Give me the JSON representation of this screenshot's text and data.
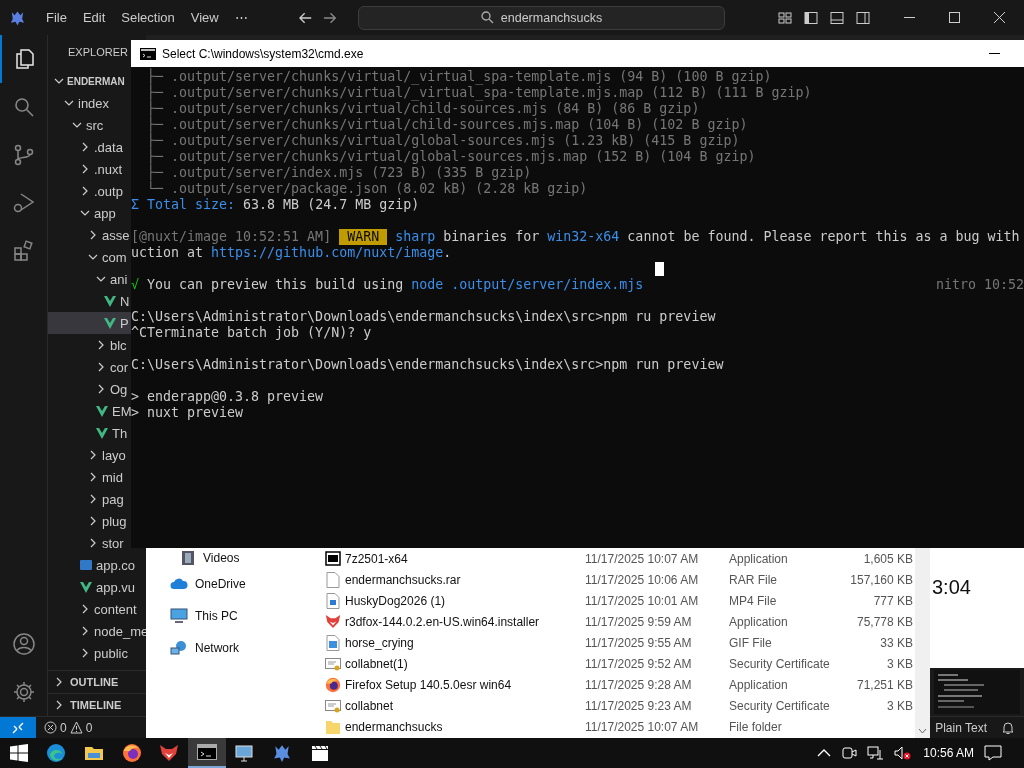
{
  "vscode": {
    "menu": [
      "File",
      "Edit",
      "Selection",
      "View",
      "⋯"
    ],
    "search": {
      "value": "endermanchsucks"
    },
    "activity": [
      {
        "kind": "explorer",
        "selected": true
      },
      {
        "kind": "search",
        "selected": false
      },
      {
        "kind": "source-control",
        "selected": false
      },
      {
        "kind": "run-debug",
        "selected": false
      },
      {
        "kind": "extensions",
        "selected": false
      }
    ],
    "activity_bottom": [
      {
        "kind": "account"
      },
      {
        "kind": "settings"
      }
    ],
    "sidebar": {
      "title": "EXPLORER",
      "tree": [
        {
          "label": "ENDERMAN",
          "kind": "root",
          "expanded": true,
          "selected": false,
          "children": [
            {
              "label": "index",
              "kind": "folder",
              "expanded": true,
              "selected": false,
              "children": [
                {
                  "label": "src",
                  "kind": "folder",
                  "expanded": true,
                  "selected": false,
                  "children": [
                    {
                      "label": ".data",
                      "kind": "folder",
                      "expanded": false,
                      "selected": false
                    },
                    {
                      "label": ".nuxt",
                      "kind": "folder",
                      "expanded": false,
                      "selected": false
                    },
                    {
                      "label": ".outp",
                      "kind": "folder",
                      "expanded": false,
                      "selected": false
                    },
                    {
                      "label": "app",
                      "kind": "folder",
                      "expanded": true,
                      "selected": false,
                      "children": [
                        {
                          "label": "asse",
                          "kind": "folder",
                          "expanded": false,
                          "selected": false
                        },
                        {
                          "label": "com",
                          "kind": "folder",
                          "expanded": true,
                          "selected": false,
                          "children": [
                            {
                              "label": "ani",
                              "kind": "folder",
                              "expanded": true,
                              "selected": false,
                              "children": [
                                {
                                  "label": "N",
                                  "kind": "vue",
                                  "selected": false
                                },
                                {
                                  "label": "P",
                                  "kind": "vue",
                                  "selected": true
                                }
                              ]
                            },
                            {
                              "label": "blc",
                              "kind": "folder",
                              "expanded": false,
                              "selected": false
                            },
                            {
                              "label": "cor",
                              "kind": "folder",
                              "expanded": false,
                              "selected": false
                            },
                            {
                              "label": "Og",
                              "kind": "folder",
                              "expanded": false,
                              "selected": false
                            },
                            {
                              "label": "EM",
                              "kind": "vue",
                              "selected": false
                            },
                            {
                              "label": "Th",
                              "kind": "vue",
                              "selected": false
                            }
                          ]
                        },
                        {
                          "label": "layo",
                          "kind": "folder",
                          "expanded": false,
                          "selected": false
                        },
                        {
                          "label": "mid",
                          "kind": "folder",
                          "expanded": false,
                          "selected": false
                        },
                        {
                          "label": "pag",
                          "kind": "folder",
                          "expanded": false,
                          "selected": false
                        },
                        {
                          "label": "plug",
                          "kind": "folder",
                          "expanded": false,
                          "selected": false
                        },
                        {
                          "label": "stor",
                          "kind": "folder",
                          "expanded": false,
                          "selected": false
                        }
                      ]
                    },
                    {
                      "label": "app.co",
                      "kind": "ts",
                      "selected": false
                    },
                    {
                      "label": "app.vu",
                      "kind": "vue",
                      "selected": false
                    },
                    {
                      "label": "content",
                      "kind": "folder",
                      "expanded": false,
                      "selected": false
                    },
                    {
                      "label": "node_me",
                      "kind": "folder",
                      "expanded": false,
                      "selected": false
                    },
                    {
                      "label": "public",
                      "kind": "folder",
                      "expanded": false,
                      "selected": false
                    }
                  ]
                }
              ]
            }
          ]
        }
      ],
      "sections": [
        {
          "label": "OUTLINE",
          "expanded": false
        },
        {
          "label": "TIMELINE",
          "expanded": false
        }
      ]
    },
    "editor": {
      "text": "3:04"
    },
    "status_bar": {
      "errors": "0",
      "warnings": "0",
      "language": "Plain Text"
    }
  },
  "cmd": {
    "title": "Select C:\\windows\\system32\\cmd.exe",
    "blocks": [
      [
        {
          "segments": [
            {
              "kind": "dim",
              "text": "  ├─ .output/server/chunks/virtual/_virtual_spa-template.mjs (94 B) (100 B gzip)"
            }
          ]
        },
        {
          "segments": [
            {
              "kind": "dim",
              "text": "  ├─ .output/server/chunks/virtual/_virtual_spa-template.mjs.map (112 B) (111 B gzip)"
            }
          ]
        },
        {
          "segments": [
            {
              "kind": "dim",
              "text": "  ├─ .output/server/chunks/virtual/child-sources.mjs (84 B) (86 B gzip)"
            }
          ]
        },
        {
          "segments": [
            {
              "kind": "dim",
              "text": "  ├─ .output/server/chunks/virtual/child-sources.mjs.map (104 B) (102 B gzip)"
            }
          ]
        },
        {
          "segments": [
            {
              "kind": "dim",
              "text": "  ├─ .output/server/chunks/virtual/global-sources.mjs (1.23 kB) (415 B gzip)"
            }
          ]
        },
        {
          "segments": [
            {
              "kind": "dim",
              "text": "  ├─ .output/server/chunks/virtual/global-sources.mjs.map (152 B) (104 B gzip)"
            }
          ]
        },
        {
          "segments": [
            {
              "kind": "dim",
              "text": "  ├─ .output/server/index.mjs (723 B) (335 B gzip)"
            }
          ]
        },
        {
          "segments": [
            {
              "kind": "dim",
              "text": "  └─ .output/server/package.json (8.02 kB) (2.28 kB gzip)"
            }
          ]
        },
        {
          "segments": [
            {
              "kind": "info",
              "text": "Σ Total size:"
            },
            {
              "kind": "plain",
              "text": " 63.8 MB (24.7 MB gzip)"
            }
          ]
        }
      ],
      [
        {
          "segments": [
            {
              "kind": "dim",
              "text": "[@nuxt/image 10:52:51 AM] "
            },
            {
              "kind": "warn",
              "text": "WARN"
            },
            {
              "kind": "info",
              "text": " sharp"
            },
            {
              "kind": "plain",
              "text": " binaries for "
            },
            {
              "kind": "info",
              "text": "win32-x64"
            },
            {
              "kind": "plain",
              "text": " cannot be found. Please report this as a bug with"
            }
          ]
        },
        {
          "segments": [
            {
              "kind": "plain",
              "text": "uction at "
            },
            {
              "kind": "info",
              "text": "https://github.com/nuxt/image"
            },
            {
              "kind": "plain",
              "text": "."
            }
          ]
        },
        {
          "cursor": true
        },
        {
          "segments": [
            {
              "kind": "ok",
              "text": "√"
            },
            {
              "kind": "plain",
              "text": " You can preview this build using "
            },
            {
              "kind": "info",
              "text": "node .output/server/index.mjs"
            },
            {
              "kind": "right",
              "text": "nitro 10:52"
            }
          ]
        }
      ],
      [
        {
          "segments": [
            {
              "kind": "plain",
              "text": "C:\\Users\\Administrator\\Downloads\\endermanchsucks\\index\\src>npm ru preview"
            }
          ]
        },
        {
          "segments": [
            {
              "kind": "plain",
              "text": "^CTerminate batch job (Y/N)? y"
            }
          ]
        }
      ],
      [
        {
          "segments": [
            {
              "kind": "plain",
              "text": "C:\\Users\\Administrator\\Downloads\\endermanchsucks\\index\\src>npm run preview"
            }
          ]
        }
      ],
      [
        {
          "segments": [
            {
              "kind": "plain",
              "text": "> enderapp@0.3.8 preview"
            }
          ]
        },
        {
          "segments": [
            {
              "kind": "plain",
              "text": "> nuxt preview"
            }
          ]
        }
      ]
    ]
  },
  "file_explorer": {
    "nav": [
      {
        "label": "Videos",
        "kind": "videos"
      },
      {
        "label": "OneDrive",
        "kind": "cloud"
      },
      {
        "label": "This PC",
        "kind": "pc"
      },
      {
        "label": "Network",
        "kind": "network"
      }
    ],
    "files": [
      {
        "name": "7z2501-x64",
        "kind": "archive-app",
        "date": "11/17/2025 10:07 AM",
        "type": "Application",
        "size": "1,605 KB"
      },
      {
        "name": "endermanchsucks.rar",
        "kind": "blank",
        "date": "11/17/2025 10:06 AM",
        "type": "RAR File",
        "size": "157,160 KB"
      },
      {
        "name": "HuskyDog2026 (1)",
        "kind": "video",
        "date": "11/17/2025 10:01 AM",
        "type": "MP4 File",
        "size": "777 KB"
      },
      {
        "name": "r3dfox-144.0.2.en-US.win64.installer",
        "kind": "red-fox",
        "date": "11/17/2025 9:59 AM",
        "type": "Application",
        "size": "75,778 KB"
      },
      {
        "name": "horse_crying",
        "kind": "image",
        "date": "11/17/2025 9:55 AM",
        "type": "GIF File",
        "size": "33 KB"
      },
      {
        "name": "collabnet(1)",
        "kind": "certificate",
        "date": "11/17/2025 9:52 AM",
        "type": "Security Certificate",
        "size": "3 KB"
      },
      {
        "name": "Firefox Setup 140.5.0esr win64",
        "kind": "fox-setup",
        "date": "11/17/2025 9:28 AM",
        "type": "Application",
        "size": "71,251 KB"
      },
      {
        "name": "collabnet",
        "kind": "certificate",
        "date": "11/17/2025 9:23 AM",
        "type": "Security Certificate",
        "size": "3 KB"
      },
      {
        "name": "endermanchsucks",
        "kind": "folder",
        "date": "11/17/2025 10:07 AM",
        "type": "File folder"
      }
    ]
  },
  "taskbar": {
    "apps": [
      {
        "kind": "start",
        "selected": false
      },
      {
        "kind": "edge",
        "selected": false
      },
      {
        "kind": "folder",
        "selected": false
      },
      {
        "kind": "firefox",
        "selected": false
      },
      {
        "kind": "red-fox",
        "selected": false
      },
      {
        "kind": "terminal",
        "selected": true
      },
      {
        "kind": "remote-desktop",
        "selected": false
      },
      {
        "kind": "editor",
        "selected": false
      },
      {
        "kind": "clapper",
        "selected": false
      }
    ],
    "clock": "10:56 AM"
  }
}
